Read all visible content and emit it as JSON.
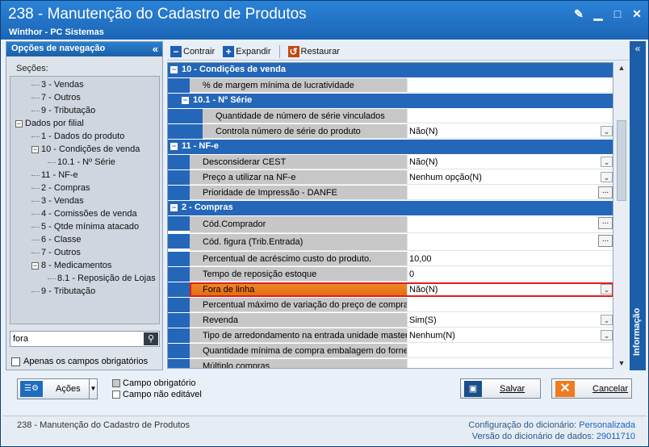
{
  "window": {
    "title": "238 - Manutenção do Cadastro de Produtos",
    "subtitle": "Winthor - PC Sistemas"
  },
  "nav": {
    "header": "Opções de navegação",
    "sections_label": "Seções:",
    "tree": [
      {
        "label": "3 - Vendas",
        "level": 1
      },
      {
        "label": "7 - Outros",
        "level": 1
      },
      {
        "label": "9 - Tributação",
        "level": 1
      },
      {
        "label": "Dados por filial",
        "level": 0,
        "expander": "⊟"
      },
      {
        "label": "1 - Dados do produto",
        "level": 1
      },
      {
        "label": "10 - Condições de venda",
        "level": 1,
        "expander": "⊟"
      },
      {
        "label": "10.1 - Nº Série",
        "level": 2
      },
      {
        "label": "11 - NF-e",
        "level": 1
      },
      {
        "label": "2 - Compras",
        "level": 1
      },
      {
        "label": "3 - Vendas",
        "level": 1
      },
      {
        "label": "4 - Comissões de venda",
        "level": 1
      },
      {
        "label": "5 - Qtde mínima atacado",
        "level": 1
      },
      {
        "label": "6 - Classe",
        "level": 1
      },
      {
        "label": "7 - Outros",
        "level": 1
      },
      {
        "label": "8 - Medicamentos",
        "level": 1,
        "expander": "⊟"
      },
      {
        "label": "8.1 - Reposição de Lojas",
        "level": 2
      },
      {
        "label": "9 - Tributação",
        "level": 1
      }
    ],
    "search_value": "fora",
    "only_required_label": "Apenas os campos obrigatórios"
  },
  "toolbar": {
    "collapse": "Contrair",
    "expand": "Expandir",
    "restore": "Restaurar"
  },
  "grid": {
    "rows": [
      {
        "type": "cat",
        "level": 0,
        "label": "10 - Condições de venda"
      },
      {
        "type": "prop",
        "level": 0,
        "label": "% de margem mínima de lucratividade",
        "value": "",
        "editor": "none"
      },
      {
        "type": "cat",
        "level": 1,
        "label": "10.1 - Nº Série"
      },
      {
        "type": "prop",
        "level": 1,
        "label": "Quantidade de número de série vinculados",
        "value": "",
        "editor": "none"
      },
      {
        "type": "prop",
        "level": 1,
        "label": "Controla número de série do produto",
        "value": "Não(N)",
        "editor": "dropdown"
      },
      {
        "type": "cat",
        "level": 0,
        "label": "11 - NF-e"
      },
      {
        "type": "prop",
        "level": 0,
        "label": "Desconsiderar CEST",
        "value": "Não(N)",
        "editor": "dropdown"
      },
      {
        "type": "prop",
        "level": 0,
        "label": "Preço a utilizar na NF-e",
        "value": "Nenhum opção(N)",
        "editor": "dropdown"
      },
      {
        "type": "prop",
        "level": 0,
        "label": "Prioridade de Impressão - DANFE",
        "value": "",
        "editor": "ellipsis"
      },
      {
        "type": "cat",
        "level": 0,
        "label": "2 - Compras"
      },
      {
        "type": "prop",
        "level": 0,
        "label": "Cód.Comprador",
        "value": "",
        "editor": "ellipsis",
        "tall": true
      },
      {
        "type": "prop",
        "level": 0,
        "label": "Cód. figura (Trib.Entrada)",
        "value": "",
        "editor": "ellipsis",
        "tall": true
      },
      {
        "type": "prop",
        "level": 0,
        "label": "Percentual de acréscimo custo do produto.",
        "value": "10,00",
        "editor": "none"
      },
      {
        "type": "prop",
        "level": 0,
        "label": "Tempo de reposição estoque",
        "value": "0",
        "editor": "none"
      },
      {
        "type": "prop",
        "level": 0,
        "label": "Fora de linha",
        "value": "Não(N)",
        "editor": "dropdown",
        "highlight": true
      },
      {
        "type": "prop",
        "level": 0,
        "label": "Percentual máximo de variação do preço de compra",
        "value": "",
        "editor": "none"
      },
      {
        "type": "prop",
        "level": 0,
        "label": "Revenda",
        "value": "Sim(S)",
        "editor": "dropdown"
      },
      {
        "type": "prop",
        "level": 0,
        "label": "Tipo de arredondamento na entrada unidade master",
        "value": "Nenhum(N)",
        "editor": "dropdown"
      },
      {
        "type": "prop",
        "level": 0,
        "label": "Quantidade mínima de compra embalagem do fornec",
        "value": "",
        "editor": "none"
      },
      {
        "type": "prop",
        "level": 0,
        "label": "Múltiplo compras",
        "value": "",
        "editor": "none"
      }
    ]
  },
  "right_panel": {
    "label": "Informação"
  },
  "footer": {
    "actions_label": "Ações",
    "legend_required": "Campo obrigatório",
    "legend_readonly": "Campo não editável",
    "save_label": "Salvar",
    "cancel_label": "Cancelar"
  },
  "status": {
    "left": "238 - Manutenção do Cadastro de Produtos",
    "config_label": "Configuração do dicionário:",
    "config_value": "Personalizada",
    "version_label": "Versão do dicionário de dados:",
    "version_value": "29011710"
  },
  "colors": {
    "title_bar": "#1c65b6",
    "category": "#2467b8",
    "highlight": "#e26d10",
    "highlight_border": "#e21b1b"
  }
}
